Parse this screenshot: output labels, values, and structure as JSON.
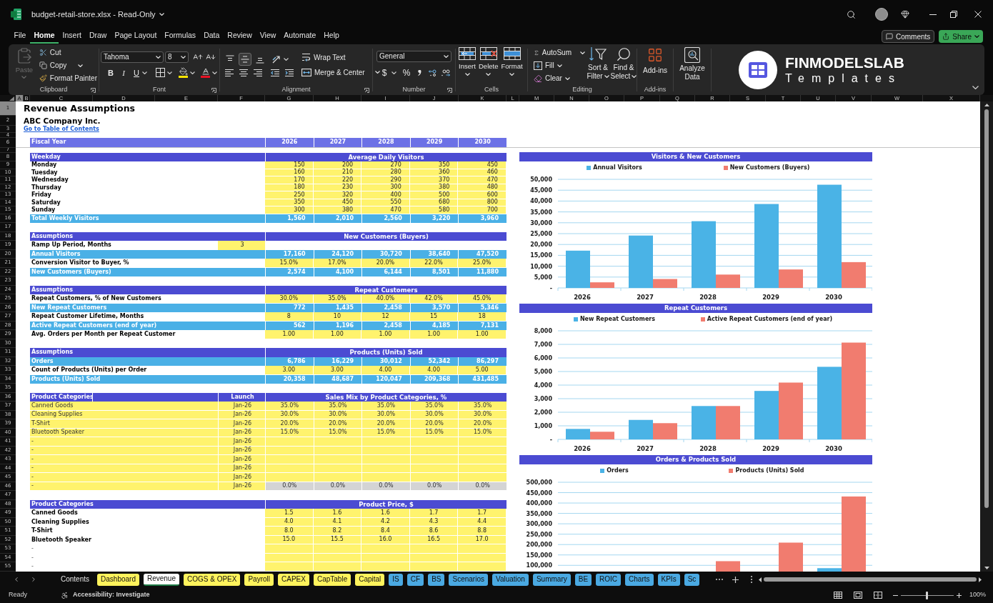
{
  "window": {
    "title": "budget-retail-store.xlsx - Read-Only"
  },
  "menu": {
    "tabs": [
      {
        "label": "File",
        "selected": false
      },
      {
        "label": "Home",
        "selected": true
      },
      {
        "label": "Insert",
        "selected": false
      },
      {
        "label": "Draw",
        "selected": false
      },
      {
        "label": "Page Layout",
        "selected": false
      },
      {
        "label": "Formulas",
        "selected": false
      },
      {
        "label": "Data",
        "selected": false
      },
      {
        "label": "Review",
        "selected": false
      },
      {
        "label": "View",
        "selected": false
      },
      {
        "label": "Automate",
        "selected": false
      },
      {
        "label": "Help",
        "selected": false
      }
    ],
    "comments": "Comments",
    "share": "Share"
  },
  "ribbon": {
    "clipboard": {
      "label": "Clipboard",
      "paste": {
        "label": "Paste",
        "disabled": true
      },
      "cut": "Cut",
      "copy": "Copy",
      "format_painter": "Format Painter"
    },
    "font": {
      "label": "Font",
      "family": "Tahoma",
      "size": "8",
      "bold": "B",
      "italic": "I",
      "underline": "U"
    },
    "alignment": {
      "label": "Alignment",
      "vertical": [
        {
          "kind": "top",
          "selected": false
        },
        {
          "kind": "middle",
          "selected": true
        },
        {
          "kind": "bottom",
          "selected": false
        }
      ],
      "wrap_text": "Wrap Text",
      "merge": "Merge & Center"
    },
    "number": {
      "label": "Number",
      "format": "General",
      "currency": "$",
      "percent": "%"
    },
    "cells": {
      "label": "Cells",
      "buttons": [
        {
          "kind": "insert",
          "label": "Insert"
        },
        {
          "kind": "delete",
          "label": "Delete"
        },
        {
          "kind": "format",
          "label": "Format"
        }
      ]
    },
    "editing": {
      "label": "Editing",
      "autosum": "AutoSum",
      "fill": "Fill",
      "clear": "Clear",
      "sort_filter": [
        "Sort &",
        "Filter"
      ],
      "find_select": [
        "Find &",
        "Select"
      ]
    },
    "addins": {
      "label": "Add-ins",
      "button": "Add-ins"
    },
    "analyze": {
      "lines": [
        "Analyze",
        "Data"
      ]
    },
    "logo": {
      "name": "FINMODELSLAB",
      "tagline": "Templates"
    }
  },
  "sheet": {
    "columns": [
      {
        "label": "A",
        "selected": true
      },
      {
        "label": "B",
        "selected": false
      },
      {
        "label": "C",
        "selected": false
      },
      {
        "label": "D",
        "selected": false
      },
      {
        "label": "E",
        "selected": false
      },
      {
        "label": "F",
        "selected": false
      },
      {
        "label": "G",
        "selected": false
      },
      {
        "label": "H",
        "selected": false
      },
      {
        "label": "I",
        "selected": false
      },
      {
        "label": "J",
        "selected": false
      },
      {
        "label": "K",
        "selected": false
      },
      {
        "label": "L",
        "selected": false
      },
      {
        "label": "M",
        "selected": false
      },
      {
        "label": "N",
        "selected": false
      },
      {
        "label": "O",
        "selected": false
      },
      {
        "label": "P",
        "selected": false
      },
      {
        "label": "Q",
        "selected": false
      },
      {
        "label": "R",
        "selected": false
      },
      {
        "label": "S",
        "selected": false
      },
      {
        "label": "T",
        "selected": false
      },
      {
        "label": "U",
        "selected": false
      },
      {
        "label": "V",
        "selected": false
      },
      {
        "label": "W",
        "selected": false
      },
      {
        "label": "X",
        "selected": false
      }
    ],
    "rows": [
      {
        "number": "1",
        "selected": true,
        "kind": "title",
        "text": "Revenue Assumptions"
      },
      {
        "number": "2",
        "selected": false,
        "kind": "subtitle",
        "text": "ABC Company Inc."
      },
      {
        "number": "3",
        "selected": false,
        "kind": "link",
        "text": "Go to Table of Contents"
      },
      {
        "number": "4",
        "selected": false,
        "kind": "spacer"
      },
      {
        "number": "6",
        "selected": false,
        "kind": "years",
        "label": "Fiscal Year",
        "values": [
          "2026",
          "2027",
          "2028",
          "2029",
          "2030"
        ]
      },
      {
        "number": "7",
        "selected": false,
        "kind": "spacer"
      },
      {
        "number": "8",
        "selected": false,
        "kind": "section",
        "label": "Weekday",
        "heading": "Average Daily Visitors"
      },
      {
        "number": "9",
        "selected": false,
        "kind": "weekday",
        "label": "Monday",
        "values": [
          "150",
          "200",
          "270",
          "350",
          "450"
        ]
      },
      {
        "number": "10",
        "selected": false,
        "kind": "weekday",
        "label": "Tuesday",
        "values": [
          "160",
          "210",
          "280",
          "360",
          "460"
        ]
      },
      {
        "number": "11",
        "selected": false,
        "kind": "weekday",
        "label": "Wednesday",
        "values": [
          "170",
          "220",
          "290",
          "370",
          "470"
        ]
      },
      {
        "number": "12",
        "selected": false,
        "kind": "weekday",
        "label": "Thursday",
        "values": [
          "180",
          "230",
          "300",
          "380",
          "480"
        ]
      },
      {
        "number": "13",
        "selected": false,
        "kind": "weekday",
        "label": "Friday",
        "values": [
          "250",
          "320",
          "400",
          "500",
          "600"
        ]
      },
      {
        "number": "14",
        "selected": false,
        "kind": "weekday",
        "label": "Saturday",
        "values": [
          "350",
          "450",
          "550",
          "680",
          "800"
        ]
      },
      {
        "number": "15",
        "selected": false,
        "kind": "weekday",
        "label": "Sunday",
        "values": [
          "300",
          "380",
          "470",
          "580",
          "700"
        ]
      },
      {
        "number": "16",
        "selected": false,
        "kind": "total",
        "label": "Total Weekly Visitors",
        "values": [
          "1,560",
          "2,010",
          "2,560",
          "3,220",
          "3,960"
        ]
      },
      {
        "number": "17",
        "selected": false,
        "kind": "blank"
      },
      {
        "number": "18",
        "selected": false,
        "kind": "section",
        "label": "Assumptions",
        "heading": "New Customers (Buyers)"
      },
      {
        "number": "19",
        "selected": false,
        "kind": "param",
        "label": "Ramp Up Period, Months",
        "value": "3"
      },
      {
        "number": "20",
        "selected": false,
        "kind": "total",
        "label": "Annual Visitors",
        "values": [
          "17,160",
          "24,120",
          "30,720",
          "38,640",
          "47,520"
        ]
      },
      {
        "number": "21",
        "selected": false,
        "kind": "input",
        "label": "Conversion Visitor to Buyer, %",
        "values": [
          "15.0%",
          "17.0%",
          "20.0%",
          "22.0%",
          "25.0%"
        ]
      },
      {
        "number": "22",
        "selected": false,
        "kind": "total",
        "label": "New Customers (Buyers)",
        "values": [
          "2,574",
          "4,100",
          "6,144",
          "8,501",
          "11,880"
        ]
      },
      {
        "number": "23",
        "selected": false,
        "kind": "blank"
      },
      {
        "number": "24",
        "selected": false,
        "kind": "section",
        "label": "Assumptions",
        "heading": "Repeat Customers"
      },
      {
        "number": "25",
        "selected": false,
        "kind": "input",
        "label": "Repeat Customers, % of New Customers",
        "values": [
          "30.0%",
          "35.0%",
          "40.0%",
          "42.0%",
          "45.0%"
        ]
      },
      {
        "number": "26",
        "selected": false,
        "kind": "total",
        "label": "New Repeat Customers",
        "values": [
          "772",
          "1,435",
          "2,458",
          "3,570",
          "5,346"
        ]
      },
      {
        "number": "27",
        "selected": false,
        "kind": "input",
        "label": "Repeat Customer Lifetime, Months",
        "values": [
          "8",
          "10",
          "12",
          "15",
          "18"
        ]
      },
      {
        "number": "28",
        "selected": false,
        "kind": "total",
        "label": "Active Repeat Customers (end of year)",
        "values": [
          "562",
          "1,196",
          "2,458",
          "4,185",
          "7,131"
        ]
      },
      {
        "number": "29",
        "selected": false,
        "kind": "input",
        "label": "Avg. Orders per Month per Repeat Customer",
        "values": [
          "1.00",
          "1.00",
          "1.00",
          "1.00",
          "1.00"
        ]
      },
      {
        "number": "30",
        "selected": false,
        "kind": "blank"
      },
      {
        "number": "31",
        "selected": false,
        "kind": "section",
        "label": "Assumptions",
        "heading": "Products (Units) Sold"
      },
      {
        "number": "32",
        "selected": false,
        "kind": "total",
        "label": "Orders",
        "values": [
          "6,786",
          "16,229",
          "30,012",
          "52,342",
          "86,297"
        ]
      },
      {
        "number": "33",
        "selected": false,
        "kind": "input",
        "label": "Count of Products (Units) per Order",
        "values": [
          "3.00",
          "3.00",
          "4.00",
          "4.00",
          "5.00"
        ]
      },
      {
        "number": "34",
        "selected": false,
        "kind": "total",
        "label": "Products (Units) Sold",
        "values": [
          "20,358",
          "48,687",
          "120,047",
          "209,368",
          "431,485"
        ]
      },
      {
        "number": "35",
        "selected": false,
        "kind": "blank"
      },
      {
        "number": "36",
        "selected": false,
        "kind": "section",
        "label": "Product Categories",
        "launch": "Launch",
        "heading": "Sales Mix by Product Categories, %"
      },
      {
        "number": "37",
        "selected": false,
        "kind": "mix",
        "label": "Canned Goods",
        "launch": "Jan-26",
        "values": [
          "35.0%",
          "35.0%",
          "35.0%",
          "35.0%",
          "35.0%"
        ]
      },
      {
        "number": "38",
        "selected": false,
        "kind": "mix",
        "label": "Cleaning Supplies",
        "launch": "Jan-26",
        "values": [
          "30.0%",
          "30.0%",
          "30.0%",
          "30.0%",
          "30.0%"
        ]
      },
      {
        "number": "39",
        "selected": false,
        "kind": "mix",
        "label": "T-Shirt",
        "launch": "Jan-26",
        "values": [
          "20.0%",
          "20.0%",
          "20.0%",
          "20.0%",
          "20.0%"
        ]
      },
      {
        "number": "40",
        "selected": false,
        "kind": "mix",
        "label": "Bluetooth Speaker",
        "launch": "Jan-26",
        "values": [
          "15.0%",
          "15.0%",
          "15.0%",
          "15.0%",
          "15.0%"
        ]
      },
      {
        "number": "41",
        "selected": false,
        "kind": "mix",
        "label": "-",
        "launch": "Jan-26"
      },
      {
        "number": "42",
        "selected": false,
        "kind": "mix",
        "label": "-",
        "launch": "Jan-26"
      },
      {
        "number": "43",
        "selected": false,
        "kind": "mix",
        "label": "-",
        "launch": "Jan-26"
      },
      {
        "number": "44",
        "selected": false,
        "kind": "mix",
        "label": "-",
        "launch": "Jan-26"
      },
      {
        "number": "45",
        "selected": false,
        "kind": "mix",
        "label": "-",
        "launch": "Jan-26"
      },
      {
        "number": "46",
        "selected": false,
        "kind": "mix_sum",
        "label": "-",
        "launch": "Jan-26",
        "values": [
          "0.0%",
          "0.0%",
          "0.0%",
          "0.0%",
          "0.0%"
        ]
      },
      {
        "number": "47",
        "selected": false,
        "kind": "blank"
      },
      {
        "number": "48",
        "selected": false,
        "kind": "section",
        "label": "Product Categories",
        "heading": "Product Price, $"
      },
      {
        "number": "49",
        "selected": false,
        "kind": "input",
        "label": "Canned Goods",
        "values": [
          "1.5",
          "1.6",
          "1.6",
          "1.7",
          "1.7"
        ]
      },
      {
        "number": "50",
        "selected": false,
        "kind": "input",
        "label": "Cleaning Supplies",
        "values": [
          "4.0",
          "4.1",
          "4.2",
          "4.3",
          "4.4"
        ]
      },
      {
        "number": "51",
        "selected": false,
        "kind": "input",
        "label": "T-Shirt",
        "values": [
          "8.0",
          "8.2",
          "8.4",
          "8.6",
          "8.8"
        ]
      },
      {
        "number": "52",
        "selected": false,
        "kind": "input",
        "label": "Bluetooth Speaker",
        "values": [
          "15.0",
          "15.5",
          "16.0",
          "16.5",
          "17.0"
        ]
      },
      {
        "number": "53",
        "selected": false,
        "kind": "spare",
        "label": "-"
      },
      {
        "number": "54",
        "selected": false,
        "kind": "spare",
        "label": "-"
      },
      {
        "number": "55",
        "selected": false,
        "kind": "spare",
        "label": "-"
      }
    ]
  },
  "charts": [
    {
      "chart_data": {
        "type": "bar",
        "title": "Visitors & New Customers",
        "categories": [
          "2026",
          "2027",
          "2028",
          "2029",
          "2030"
        ],
        "series": [
          {
            "name": "Annual Visitors",
            "color": "#4ab3e6",
            "values": [
              17160,
              24120,
              30720,
              38640,
              47520
            ]
          },
          {
            "name": "New Customers (Buyers)",
            "color": "#f17c6f",
            "values": [
              2574,
              4100,
              6144,
              8501,
              11880
            ]
          }
        ],
        "stacked": false,
        "grid": true,
        "legend": "top",
        "ylim": [
          0,
          50000
        ],
        "yticks": [
          {
            "value": 0,
            "label": "-"
          },
          {
            "value": 5000,
            "label": "5,000"
          },
          {
            "value": 10000,
            "label": "10,000"
          },
          {
            "value": 15000,
            "label": "15,000"
          },
          {
            "value": 20000,
            "label": "20,000"
          },
          {
            "value": 25000,
            "label": "25,000"
          },
          {
            "value": 30000,
            "label": "30,000"
          },
          {
            "value": 35000,
            "label": "35,000"
          },
          {
            "value": 40000,
            "label": "40,000"
          },
          {
            "value": 45000,
            "label": "45,000"
          },
          {
            "value": 50000,
            "label": "50,000"
          }
        ]
      }
    },
    {
      "chart_data": {
        "type": "bar",
        "title": "Repeat Customers",
        "categories": [
          "2026",
          "2027",
          "2028",
          "2029",
          "2030"
        ],
        "series": [
          {
            "name": "New Repeat Customers",
            "color": "#4ab3e6",
            "values": [
              772,
              1435,
              2458,
              3570,
              5346
            ]
          },
          {
            "name": "Active Repeat Customers (end of year)",
            "color": "#f17c6f",
            "values": [
              562,
              1196,
              2458,
              4185,
              7131
            ]
          }
        ],
        "stacked": false,
        "grid": true,
        "legend": "top",
        "ylim": [
          0,
          8000
        ],
        "yticks": [
          {
            "value": 0,
            "label": "-"
          },
          {
            "value": 1000,
            "label": "1,000"
          },
          {
            "value": 2000,
            "label": "2,000"
          },
          {
            "value": 3000,
            "label": "3,000"
          },
          {
            "value": 4000,
            "label": "4,000"
          },
          {
            "value": 5000,
            "label": "5,000"
          },
          {
            "value": 6000,
            "label": "6,000"
          },
          {
            "value": 7000,
            "label": "7,000"
          },
          {
            "value": 8000,
            "label": "8,000"
          }
        ]
      }
    },
    {
      "chart_data": {
        "type": "bar",
        "title": "Orders & Products Sold",
        "series": [
          {
            "name": "Orders",
            "color": "#4ab3e6",
            "values": [
              null,
              null,
              null,
              null,
              86297
            ]
          },
          {
            "name": "Products (Units) Sold",
            "color": "#f17c6f",
            "values": [
              null,
              null,
              120047,
              209368,
              431485
            ]
          }
        ],
        "stacked": false,
        "grid": true,
        "legend": "top",
        "ylim": [
          70000,
          500000
        ],
        "yticks": [
          {
            "value": 100000,
            "label": "100,000"
          },
          {
            "value": 150000,
            "label": "150,000"
          },
          {
            "value": 200000,
            "label": "200,000"
          },
          {
            "value": 250000,
            "label": "250,000"
          },
          {
            "value": 300000,
            "label": "300,000"
          },
          {
            "value": 350000,
            "label": "350,000"
          },
          {
            "value": 400000,
            "label": "400,000"
          },
          {
            "value": 450000,
            "label": "450,000"
          },
          {
            "value": 500000,
            "label": "500,000"
          }
        ]
      }
    }
  ],
  "sheet_tabs": [
    {
      "label": "Contents",
      "selected": false
    },
    {
      "label": "Dashboard",
      "color": "#fff35c",
      "selected": false
    },
    {
      "label": "Revenue",
      "selected": true
    },
    {
      "label": "COGS & OPEX",
      "color": "#fff35c",
      "selected": false
    },
    {
      "label": "Payroll",
      "color": "#fff35c",
      "selected": false
    },
    {
      "label": "CAPEX",
      "color": "#fff35c",
      "selected": false
    },
    {
      "label": "CapTable",
      "color": "#fff35c",
      "selected": false
    },
    {
      "label": "Capital",
      "color": "#fff35c",
      "selected": false
    },
    {
      "label": "IS",
      "color": "#4aa9e2",
      "selected": false
    },
    {
      "label": "CF",
      "color": "#4aa9e2",
      "selected": false
    },
    {
      "label": "BS",
      "color": "#4aa9e2",
      "selected": false
    },
    {
      "label": "Scenarios",
      "color": "#4aa9e2",
      "selected": false
    },
    {
      "label": "Valuation",
      "color": "#4aa9e2",
      "selected": false
    },
    {
      "label": "Summary",
      "color": "#4aa9e2",
      "selected": false
    },
    {
      "label": "BE",
      "color": "#4aa9e2",
      "selected": false
    },
    {
      "label": "ROIC",
      "color": "#4aa9e2",
      "selected": false
    },
    {
      "label": "Charts",
      "color": "#4aa9e2",
      "selected": false
    },
    {
      "label": "KPIs",
      "color": "#4aa9e2",
      "selected": false
    },
    {
      "label": "Sc",
      "color": "#4aa9e2",
      "selected": false
    }
  ],
  "status_bar": {
    "status": "Ready",
    "accessibility": "Accessibility: Investigate",
    "zoom": {
      "level": 0.5,
      "reading": "100%"
    }
  }
}
